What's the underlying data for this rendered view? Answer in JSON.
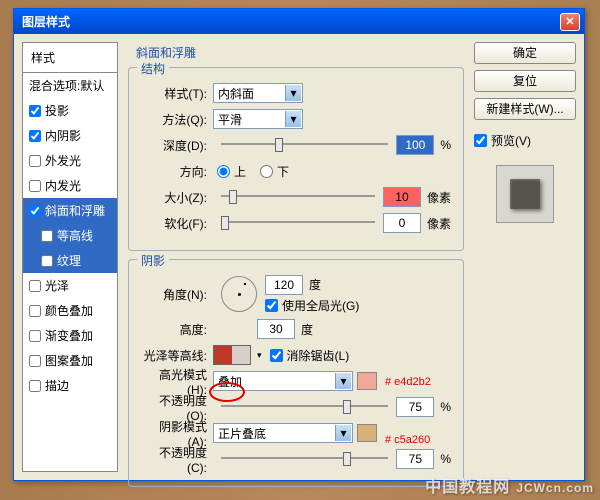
{
  "window": {
    "title": "图层样式"
  },
  "sidebar": {
    "head": "样式",
    "items": [
      {
        "label": "混合选项:默认",
        "checked": null
      },
      {
        "label": "投影",
        "checked": true
      },
      {
        "label": "内阴影",
        "checked": true
      },
      {
        "label": "外发光",
        "checked": false
      },
      {
        "label": "内发光",
        "checked": false
      },
      {
        "label": "斜面和浮雕",
        "checked": true,
        "selected": true
      },
      {
        "label": "等高线",
        "checked": false,
        "sub": true,
        "selected": true
      },
      {
        "label": "纹理",
        "checked": false,
        "sub": true,
        "selected": true
      },
      {
        "label": "光泽",
        "checked": false
      },
      {
        "label": "颜色叠加",
        "checked": false
      },
      {
        "label": "渐变叠加",
        "checked": false
      },
      {
        "label": "图案叠加",
        "checked": false
      },
      {
        "label": "描边",
        "checked": false
      }
    ]
  },
  "panel": {
    "title": "斜面和浮雕",
    "structure": {
      "legend": "结构",
      "style": {
        "label": "样式(T):",
        "value": "内斜面"
      },
      "method": {
        "label": "方法(Q):",
        "value": "平滑"
      },
      "depth": {
        "label": "深度(D):",
        "value": "100",
        "unit": "%"
      },
      "direction": {
        "label": "方向:",
        "up": "上",
        "down": "下"
      },
      "size": {
        "label": "大小(Z):",
        "value": "10",
        "unit": "像素"
      },
      "soften": {
        "label": "软化(F):",
        "value": "0",
        "unit": "像素"
      }
    },
    "shading": {
      "legend": "阴影",
      "angle": {
        "label": "角度(N):",
        "value": "120",
        "unit": "度"
      },
      "global": {
        "label": "使用全局光(G)"
      },
      "altitude": {
        "label": "高度:",
        "value": "30",
        "unit": "度"
      },
      "gloss": {
        "label": "光泽等高线:",
        "antialias": "消除锯齿(L)"
      },
      "highlight": {
        "label": "高光模式(H):",
        "mode": "叠加",
        "color": "#e4d2b2"
      },
      "hi_opacity": {
        "label": "不透明度(O):",
        "value": "75",
        "unit": "%"
      },
      "shadow": {
        "label": "阴影模式(A):",
        "mode": "正片叠底",
        "color": "#c5a260"
      },
      "sh_opacity": {
        "label": "不透明度(C):",
        "value": "75",
        "unit": "%"
      }
    }
  },
  "buttons": {
    "ok": "确定",
    "cancel": "复位",
    "newstyle": "新建样式(W)...",
    "preview": "预览(V)"
  },
  "annotations": {
    "a1": "# e4d2b2",
    "a2": "# c5a260"
  },
  "watermark": {
    "cn": "中国教程网",
    "en": "JCWcn.com"
  }
}
